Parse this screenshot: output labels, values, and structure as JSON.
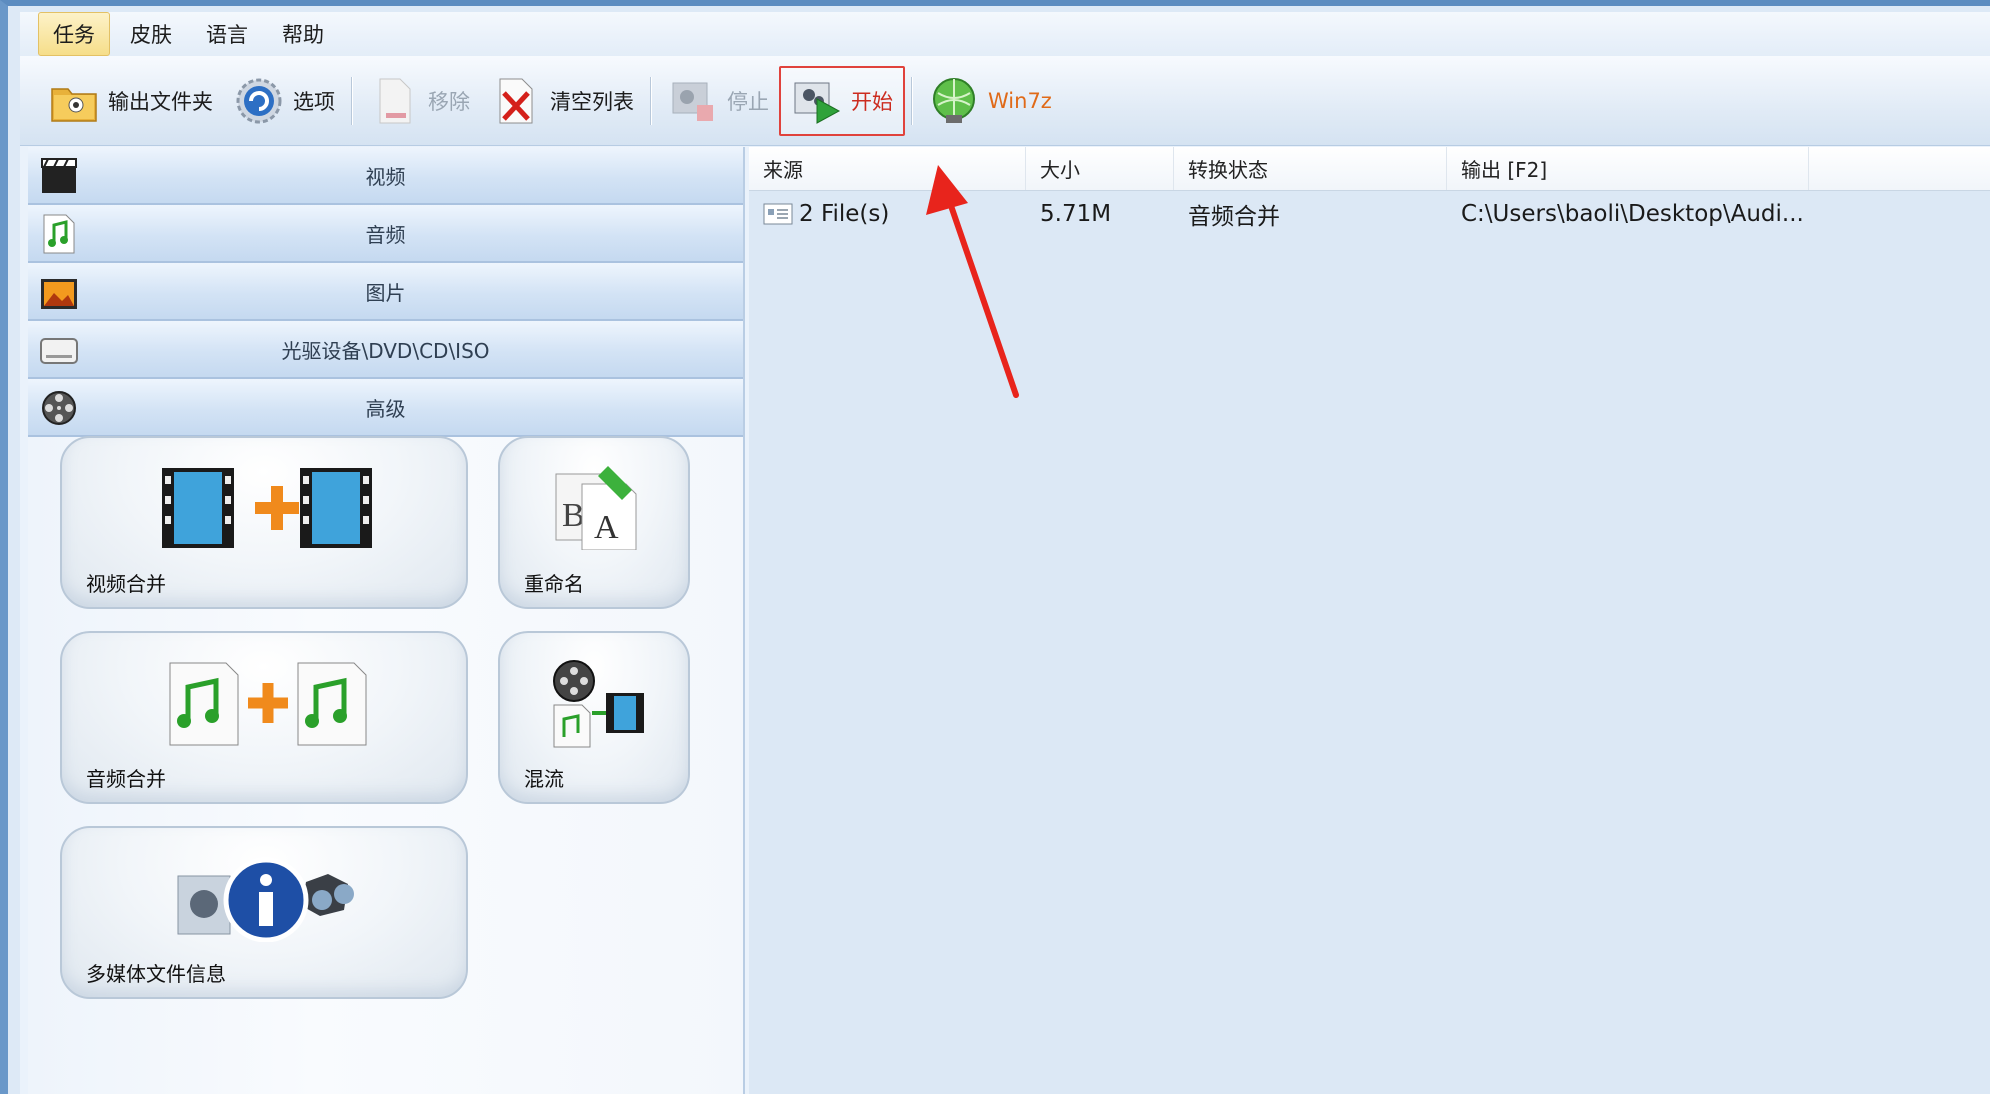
{
  "menu": {
    "items": [
      "任务",
      "皮肤",
      "语言",
      "帮助"
    ]
  },
  "toolbar": {
    "output_folder": "输出文件夹",
    "options": "选项",
    "remove": "移除",
    "clear_list": "清空列表",
    "stop": "停止",
    "start": "开始",
    "win7z": "Win7z"
  },
  "categories": [
    "视频",
    "音频",
    "图片",
    "光驱设备\\DVD\\CD\\ISO",
    "高级"
  ],
  "tiles": {
    "video_merge": "视频合并",
    "rename": "重命名",
    "audio_merge": "音频合并",
    "mux": "混流",
    "media_info": "多媒体文件信息"
  },
  "list": {
    "headers": [
      "来源",
      "大小",
      "转换状态",
      "输出 [F2]"
    ],
    "rows": [
      {
        "source": "2 File(s)",
        "size": "5.71M",
        "status": "音频合并",
        "output": "C:\\Users\\baoli\\Desktop\\Audi..."
      }
    ]
  },
  "colors": {
    "highlight": "#e0423c",
    "accent": "#4a7fb8"
  }
}
